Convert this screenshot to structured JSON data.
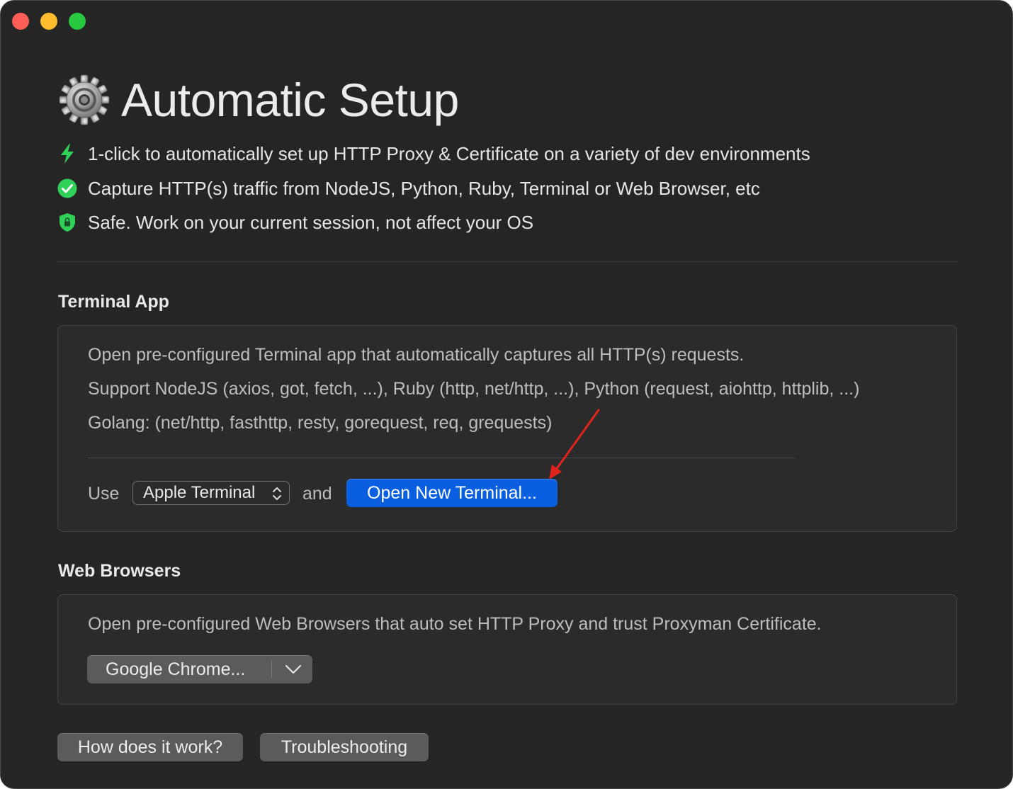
{
  "window": {
    "controls": [
      "close",
      "minimize",
      "zoom"
    ]
  },
  "header": {
    "icon": "gear-icon",
    "title": "Automatic Setup"
  },
  "features": [
    {
      "icon": "lightning-icon",
      "color": "#30d158",
      "text": "1-click to automatically set up HTTP Proxy & Certificate on a variety of dev environments"
    },
    {
      "icon": "checkmark-circle-icon",
      "color": "#30d158",
      "text": "Capture HTTP(s) traffic from NodeJS, Python, Ruby, Terminal or Web Browser, etc"
    },
    {
      "icon": "shield-lock-icon",
      "color": "#30d158",
      "text": "Safe. Work on your current session, not affect your OS"
    }
  ],
  "terminal_section": {
    "title": "Terminal App",
    "lines": [
      "Open pre-configured Terminal app that automatically captures all HTTP(s) requests.",
      "Support NodeJS (axios, got, fetch, ...), Ruby (http, net/http, ...), Python (request, aiohttp, httplib, ...)",
      "Golang: (net/http, fasthttp, resty, gorequest, req, grequests)"
    ],
    "use_label": "Use",
    "terminal_select_value": "Apple Terminal",
    "and_label": "and",
    "open_button_label": "Open New Terminal..."
  },
  "browsers_section": {
    "title": "Web Browsers",
    "description": "Open pre-configured Web Browsers that auto set HTTP Proxy and trust Proxyman Certificate.",
    "browser_button_label": "Google Chrome..."
  },
  "footer": {
    "how_label": "How does it work?",
    "troubleshooting_label": "Troubleshooting"
  },
  "colors": {
    "accent_button": "#0a5fe0",
    "annotation_arrow": "#e0241b"
  }
}
